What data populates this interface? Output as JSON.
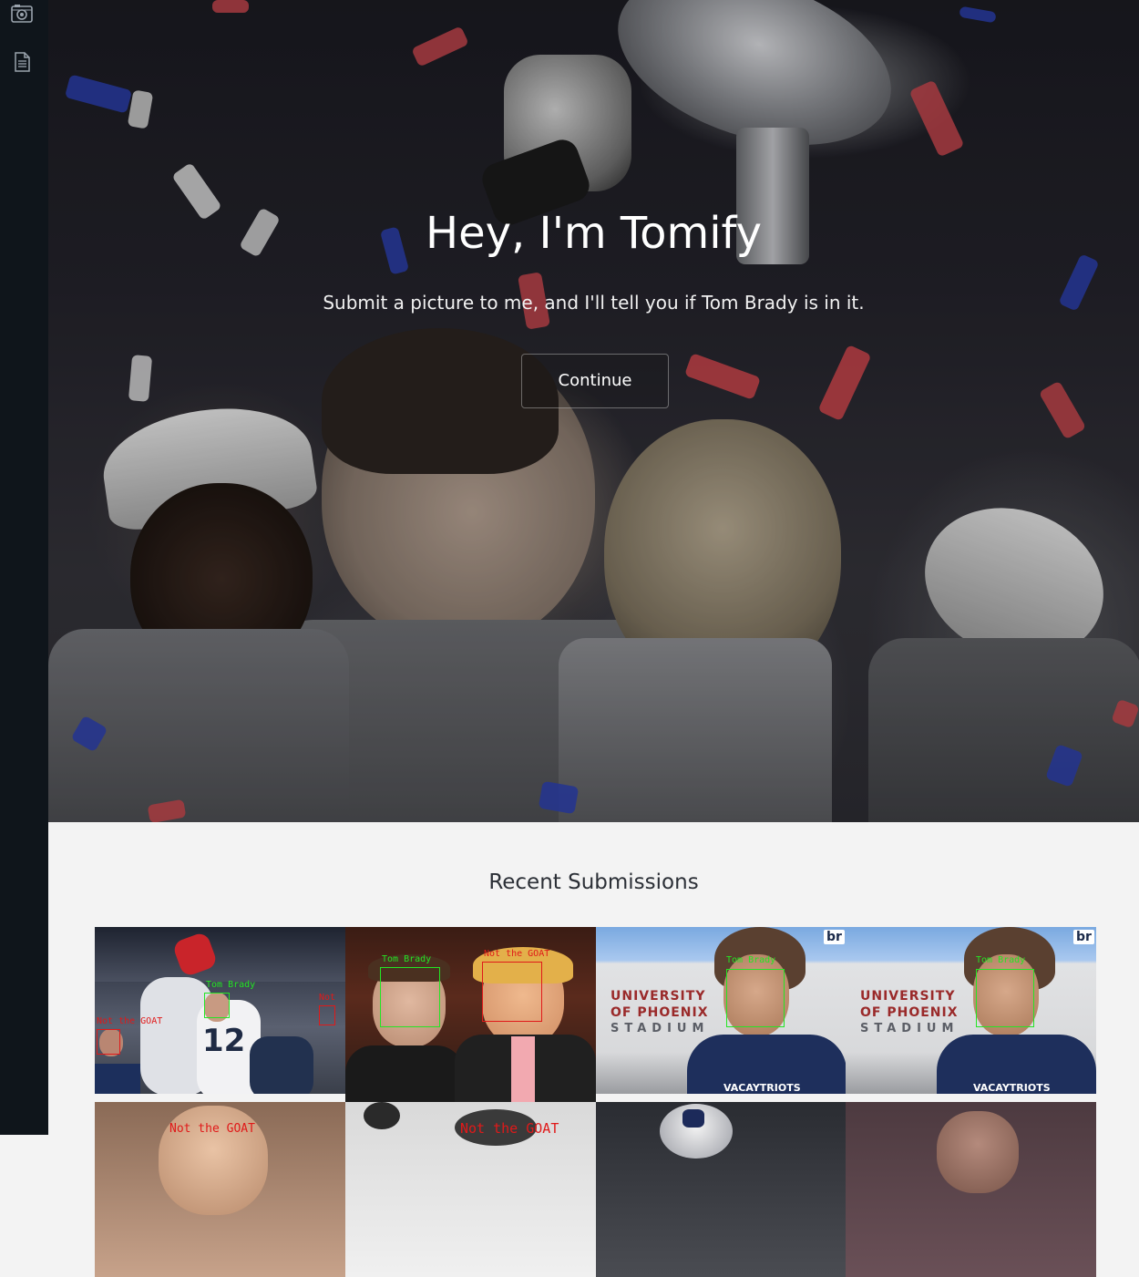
{
  "sidebar": {
    "items": [
      {
        "icon": "camera-icon"
      },
      {
        "icon": "document-icon"
      }
    ]
  },
  "hero": {
    "title": "Hey, I'm Tomify",
    "subtitle": "Submit a picture to me, and I'll tell you if Tom Brady is in it.",
    "button_label": "Continue"
  },
  "submissions": {
    "title": "Recent Submissions",
    "thumbs": [
      {
        "labels": [
          "Tom Brady",
          "Not the GOAT",
          "Not"
        ],
        "jersey": "12"
      },
      {
        "labels": [
          "Tom Brady",
          "Not the GOAT"
        ]
      },
      {
        "labels": [
          "Tom Brady"
        ],
        "sign": [
          "UNIVERSITY",
          "OF PHOENIX",
          "STADIUM"
        ],
        "shirt": "VACAYTRIOTS",
        "badge": "br"
      },
      {
        "labels": [
          "Tom Brady"
        ],
        "sign": [
          "UNIVERSITY",
          "OF PHOENIX",
          "STADIUM"
        ],
        "shirt": "VACAYTRIOTS",
        "badge": "br"
      },
      {
        "labels": [
          "Not the GOAT"
        ]
      },
      {
        "labels": [
          "Not the GOAT"
        ]
      },
      {
        "labels": []
      },
      {
        "labels": []
      }
    ]
  },
  "colors": {
    "sidebar_bg": "#0f151b",
    "page_bg": "#f3f3f3",
    "detect_match": "#24e524",
    "detect_nomatch": "#e01919"
  }
}
